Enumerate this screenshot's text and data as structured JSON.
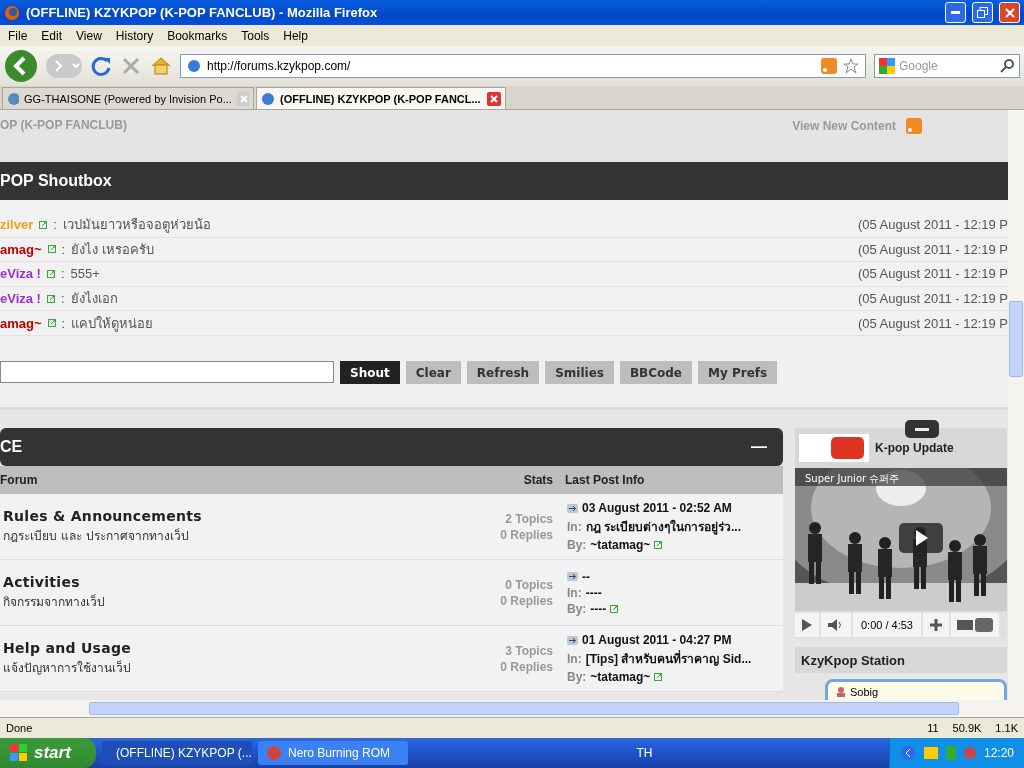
{
  "window": {
    "title": "(OFFLINE) KZYKPOP (K-POP FANCLUB) - Mozilla Firefox"
  },
  "menu": [
    "File",
    "Edit",
    "View",
    "History",
    "Bookmarks",
    "Tools",
    "Help"
  ],
  "navigation": {
    "url": "http://forums.kzykpop.com/",
    "search_placeholder": "Google"
  },
  "tabs": [
    {
      "label": "GG-THAISONE (Powered by Invision Po...",
      "selected": false
    },
    {
      "label": "(OFFLINE) KZYKPOP (K-POP FANCL...",
      "selected": true
    }
  ],
  "page_header": {
    "site_title": "OP (K-POP FANCLUB)",
    "view_new": "View New Content"
  },
  "shoutbox": {
    "title": "POP Shoutbox",
    "shouts": [
      {
        "name": "zilver",
        "color": "#e8a317",
        "separator": ":",
        "message": "เวปมันยาวหรือจอตูห่วยน้อ",
        "time": "(05 August 2011 - 12:19 P"
      },
      {
        "name": "amag~",
        "color": "#c00000",
        "separator": ":",
        "message": "ยังไง เหรอครับ",
        "time": "(05 August 2011 - 12:19 P"
      },
      {
        "name": "eViza !",
        "color": "#9933cc",
        "separator": ":",
        "message": "555+",
        "time": "(05 August 2011 - 12:19 P"
      },
      {
        "name": "eViza !",
        "color": "#9933cc",
        "separator": ":",
        "message": "ยังไงเอก",
        "time": "(05 August 2011 - 12:19 P"
      },
      {
        "name": "amag~",
        "color": "#c00000",
        "separator": ":",
        "message": "แคปให้ดูหน่อย",
        "time": "(05 August 2011 - 12:19 P"
      }
    ],
    "buttons": [
      {
        "label": "Shout",
        "kind": "primary"
      },
      {
        "label": "Clear",
        "kind": "secondary"
      },
      {
        "label": "Refresh",
        "kind": "secondary"
      },
      {
        "label": "Smilies",
        "kind": "secondary"
      },
      {
        "label": "BBCode",
        "kind": "secondary"
      },
      {
        "label": "My Prefs",
        "kind": "secondary"
      }
    ]
  },
  "category": {
    "title": "CE",
    "collapse": "—",
    "columns": [
      "Forum",
      "Stats",
      "Last Post Info"
    ],
    "forums": [
      {
        "name": "Rules & Announcements",
        "description": "กฎระเบียบ และ ประกาศจากทางเว็ป",
        "topics": "2 Topics",
        "replies": "0 Replies",
        "last_date": "03 August 2011 - 02:52 AM",
        "in_label": "In:",
        "in": "กฎ ระเบียบต่างๆในการอยู่ร่ว...",
        "by_label": "By:",
        "by": "~tatamag~"
      },
      {
        "name": "Activities",
        "description": "กิจกรรมจากทางเว็ป",
        "topics": "0 Topics",
        "replies": "0 Replies",
        "last_date": "--",
        "in_label": "In:",
        "in": "----",
        "by_label": "By:",
        "by": "----"
      },
      {
        "name": "Help and Usage",
        "description": "แจ้งปัญหาการใช้งานเว็ป",
        "topics": "3 Topics",
        "replies": "0 Replies",
        "last_date": "01 August 2011 - 04:27 PM",
        "in_label": "In:",
        "in": "[Tips] สำหรับคนที่ราคาญ Sid...",
        "by_label": "By:",
        "by": "~tatamag~"
      }
    ]
  },
  "sidebar": {
    "video_block": {
      "title": "K-pop Update",
      "video_title": "Super Junior 슈퍼주",
      "time": "0:00 / 4:53"
    },
    "station": {
      "title": "KzyKpop Station",
      "users": [
        "Sobig"
      ]
    }
  },
  "status_bar": {
    "text": "Done",
    "items": [
      "11",
      "50.9K",
      "1.1K"
    ]
  },
  "taskbar": {
    "start": "start",
    "tasks": [
      {
        "label": "(OFFLINE) KZYKPOP (...",
        "selected": true
      },
      {
        "label": "Nero Burning ROM",
        "selected": false
      }
    ],
    "language": "TH",
    "clock": "12:20"
  }
}
